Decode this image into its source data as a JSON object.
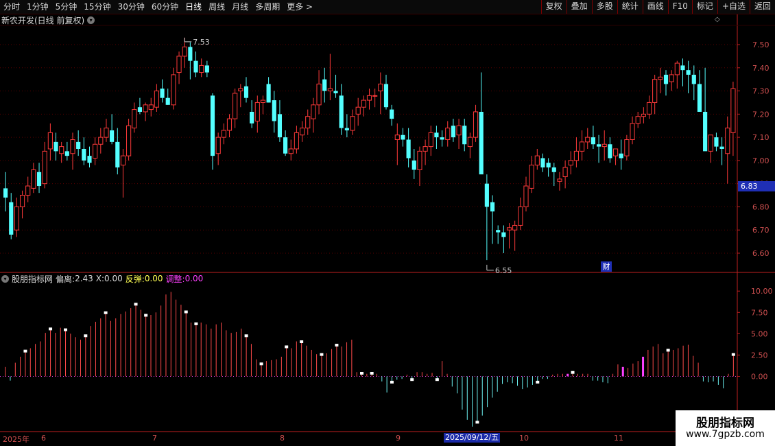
{
  "timeframes": [
    "分时",
    "1分钟",
    "5分钟",
    "15分钟",
    "30分钟",
    "60分钟",
    "日线",
    "周线",
    "月线",
    "多周期",
    "更多 >"
  ],
  "active_timeframe": "日线",
  "tools": [
    "复权",
    "叠加",
    "多股",
    "统计",
    "画线",
    "F10",
    "标记",
    "+自选",
    "返回"
  ],
  "stock_title": "新农开发(日线 前复权)",
  "indicator": {
    "name": "股朋指标网",
    "pianli_label": "偏离:",
    "pianli_value": "2.43",
    "x_label": "X:",
    "x_value": "0.00",
    "fantan_label": "反弹:",
    "fantan_value": "0.00",
    "tiaozheng_label": "调整:",
    "tiaozheng_value": "0.00"
  },
  "current_price_tag": "6.83",
  "cai_badge": "财",
  "date_badge": "2025/09/12/五",
  "year_label": "2025年",
  "month_labels": [
    "6",
    "7",
    "8",
    "9",
    "10",
    "11"
  ],
  "watermark": {
    "title": "股朋指标网",
    "url": "www.7gpzb.com"
  },
  "colors": {
    "up": "#ff3a3a",
    "down": "#54ffff",
    "pink": "#ff40ff",
    "yellow": "#ffff54",
    "axis": "#c02020"
  },
  "chart_data": [
    {
      "type": "candlestick",
      "title": "新农开发(日线 前复权)",
      "y_ticks": [
        "7.50",
        "7.40",
        "7.30",
        "7.20",
        "7.10",
        "7.00",
        "6.90",
        "6.80",
        "6.70",
        "6.60"
      ],
      "ylim": [
        6.52,
        7.58
      ],
      "annotations": [
        {
          "text": "7.53",
          "value": 7.53
        },
        {
          "text": "6.55",
          "value": 6.55
        }
      ],
      "ohlc": [
        [
          6.88,
          6.95,
          6.78,
          6.84
        ],
        [
          6.82,
          6.86,
          6.66,
          6.68
        ],
        [
          6.7,
          6.84,
          6.67,
          6.8
        ],
        [
          6.8,
          6.87,
          6.75,
          6.85
        ],
        [
          6.85,
          6.93,
          6.82,
          6.89
        ],
        [
          6.88,
          6.99,
          6.86,
          6.96
        ],
        [
          6.95,
          6.99,
          6.86,
          6.89
        ],
        [
          6.9,
          7.08,
          6.88,
          7.04
        ],
        [
          7.05,
          7.16,
          7.0,
          7.12
        ],
        [
          7.08,
          7.12,
          7.0,
          7.04
        ],
        [
          7.03,
          7.08,
          6.99,
          7.06
        ],
        [
          7.04,
          7.08,
          7.0,
          7.02
        ],
        [
          7.03,
          7.12,
          6.96,
          7.09
        ],
        [
          7.08,
          7.13,
          7.02,
          7.05
        ],
        [
          7.05,
          7.1,
          6.98,
          7.0
        ],
        [
          7.02,
          7.06,
          6.97,
          6.99
        ],
        [
          7.01,
          7.1,
          6.98,
          7.07
        ],
        [
          7.07,
          7.14,
          7.03,
          7.1
        ],
        [
          7.1,
          7.18,
          7.08,
          7.14
        ],
        [
          7.13,
          7.2,
          7.07,
          7.08
        ],
        [
          7.08,
          7.14,
          6.94,
          6.97
        ],
        [
          6.98,
          7.05,
          6.84,
          7.02
        ],
        [
          7.02,
          7.18,
          7.0,
          7.15
        ],
        [
          7.14,
          7.25,
          7.12,
          7.22
        ],
        [
          7.23,
          7.27,
          7.2,
          7.21
        ],
        [
          7.21,
          7.25,
          7.17,
          7.24
        ],
        [
          7.22,
          7.27,
          7.19,
          7.24
        ],
        [
          7.23,
          7.33,
          7.21,
          7.3
        ],
        [
          7.31,
          7.35,
          7.25,
          7.27
        ],
        [
          7.27,
          7.31,
          7.24,
          7.24
        ],
        [
          7.24,
          7.4,
          7.22,
          7.37
        ],
        [
          7.38,
          7.47,
          7.33,
          7.45
        ],
        [
          7.45,
          7.53,
          7.4,
          7.49
        ],
        [
          7.49,
          7.51,
          7.35,
          7.43
        ],
        [
          7.43,
          7.47,
          7.36,
          7.38
        ],
        [
          7.38,
          7.44,
          7.36,
          7.41
        ],
        [
          7.41,
          7.43,
          7.36,
          7.38
        ],
        [
          7.28,
          7.29,
          6.96,
          7.02
        ],
        [
          7.03,
          7.12,
          6.98,
          7.1
        ],
        [
          7.1,
          7.16,
          7.07,
          7.13
        ],
        [
          7.13,
          7.2,
          7.1,
          7.18
        ],
        [
          7.18,
          7.31,
          7.14,
          7.29
        ],
        [
          7.3,
          7.33,
          7.23,
          7.31
        ],
        [
          7.32,
          7.36,
          7.25,
          7.27
        ],
        [
          7.21,
          7.26,
          7.14,
          7.16
        ],
        [
          7.17,
          7.28,
          7.12,
          7.25
        ],
        [
          7.25,
          7.28,
          7.2,
          7.26
        ],
        [
          7.33,
          7.36,
          7.25,
          7.25
        ],
        [
          7.26,
          7.3,
          7.12,
          7.17
        ],
        [
          7.2,
          7.26,
          7.08,
          7.1
        ],
        [
          7.1,
          7.13,
          7.02,
          7.03
        ],
        [
          7.03,
          7.09,
          7.0,
          7.05
        ],
        [
          7.05,
          7.15,
          7.03,
          7.12
        ],
        [
          7.11,
          7.17,
          7.08,
          7.14
        ],
        [
          7.14,
          7.22,
          7.11,
          7.19
        ],
        [
          7.18,
          7.27,
          7.12,
          7.24
        ],
        [
          7.24,
          7.39,
          7.2,
          7.33
        ],
        [
          7.35,
          7.4,
          7.25,
          7.3
        ],
        [
          7.3,
          7.46,
          7.26,
          7.31
        ],
        [
          7.3,
          7.37,
          7.27,
          7.29
        ],
        [
          7.28,
          7.33,
          7.11,
          7.14
        ],
        [
          7.14,
          7.2,
          7.1,
          7.13
        ],
        [
          7.13,
          7.22,
          7.11,
          7.19
        ],
        [
          7.2,
          7.27,
          7.15,
          7.23
        ],
        [
          7.23,
          7.28,
          7.19,
          7.26
        ],
        [
          7.26,
          7.31,
          7.22,
          7.28
        ],
        [
          7.28,
          7.31,
          7.23,
          7.28
        ],
        [
          7.3,
          7.38,
          7.2,
          7.33
        ],
        [
          7.33,
          7.37,
          7.22,
          7.23
        ],
        [
          7.22,
          7.24,
          7.15,
          7.18
        ],
        [
          7.09,
          7.16,
          6.98,
          7.11
        ],
        [
          7.11,
          7.14,
          7.06,
          7.09
        ],
        [
          7.09,
          7.14,
          6.97,
          7.01
        ],
        [
          7.0,
          7.05,
          6.92,
          6.96
        ],
        [
          6.96,
          7.06,
          6.89,
          7.04
        ],
        [
          7.04,
          7.09,
          6.98,
          7.06
        ],
        [
          7.06,
          7.15,
          7.02,
          7.12
        ],
        [
          7.12,
          7.15,
          7.05,
          7.1
        ],
        [
          7.1,
          7.13,
          7.06,
          7.09
        ],
        [
          7.09,
          7.17,
          7.06,
          7.14
        ],
        [
          7.15,
          7.18,
          7.08,
          7.1
        ],
        [
          7.11,
          7.18,
          7.05,
          7.15
        ],
        [
          7.15,
          7.18,
          7.04,
          7.07
        ],
        [
          7.06,
          7.12,
          7.01,
          7.1
        ],
        [
          7.1,
          7.24,
          7.08,
          7.21
        ],
        [
          7.21,
          7.38,
          6.95,
          6.94
        ],
        [
          6.9,
          6.94,
          6.57,
          6.8
        ],
        [
          6.82,
          6.85,
          6.64,
          6.78
        ],
        [
          6.7,
          6.72,
          6.64,
          6.69
        ],
        [
          6.69,
          6.72,
          6.6,
          6.67
        ],
        [
          6.7,
          6.73,
          6.62,
          6.71
        ],
        [
          6.7,
          6.74,
          6.61,
          6.72
        ],
        [
          6.72,
          6.84,
          6.7,
          6.8
        ],
        [
          6.8,
          6.93,
          6.78,
          6.89
        ],
        [
          6.88,
          7.02,
          6.86,
          6.98
        ],
        [
          6.98,
          7.05,
          6.96,
          7.02
        ],
        [
          7.01,
          7.03,
          6.95,
          6.97
        ],
        [
          6.99,
          7.01,
          6.93,
          6.97
        ],
        [
          6.97,
          6.99,
          6.89,
          6.95
        ],
        [
          6.91,
          6.95,
          6.87,
          6.92
        ],
        [
          6.93,
          7.0,
          6.88,
          6.97
        ],
        [
          6.98,
          7.04,
          6.94,
          7.0
        ],
        [
          7.0,
          7.1,
          6.97,
          7.04
        ],
        [
          7.04,
          7.13,
          7.0,
          7.08
        ],
        [
          7.08,
          7.14,
          7.05,
          7.1
        ],
        [
          7.1,
          7.15,
          7.05,
          7.07
        ],
        [
          7.07,
          7.11,
          6.99,
          7.06
        ],
        [
          7.06,
          7.13,
          7.0,
          7.07
        ],
        [
          7.07,
          7.1,
          6.99,
          7.01
        ],
        [
          7.02,
          7.05,
          6.98,
          7.05
        ],
        [
          7.03,
          7.09,
          6.96,
          7.01
        ],
        [
          7.02,
          7.11,
          7.0,
          7.09
        ],
        [
          7.09,
          7.19,
          7.07,
          7.16
        ],
        [
          7.16,
          7.21,
          7.14,
          7.19
        ],
        [
          7.19,
          7.23,
          7.16,
          7.2
        ],
        [
          7.2,
          7.28,
          7.18,
          7.25
        ],
        [
          7.25,
          7.37,
          7.2,
          7.35
        ],
        [
          7.35,
          7.4,
          7.29,
          7.36
        ],
        [
          7.37,
          7.39,
          7.28,
          7.33
        ],
        [
          7.34,
          7.39,
          7.3,
          7.37
        ],
        [
          7.37,
          7.43,
          7.31,
          7.42
        ],
        [
          7.41,
          7.44,
          7.32,
          7.39
        ],
        [
          7.39,
          7.43,
          7.29,
          7.37
        ],
        [
          7.37,
          7.41,
          7.26,
          7.33
        ],
        [
          7.33,
          7.39,
          7.24,
          7.21
        ],
        [
          7.21,
          7.4,
          7.13,
          7.04
        ],
        [
          7.04,
          7.08,
          6.99,
          7.11
        ],
        [
          7.1,
          7.12,
          7.04,
          7.06
        ],
        [
          7.06,
          7.1,
          6.98,
          7.05
        ],
        [
          7.03,
          7.19,
          6.9,
          7.14
        ],
        [
          7.12,
          7.34,
          7.02,
          7.31
        ]
      ]
    },
    {
      "type": "bar",
      "title": "股朋指标网",
      "y_ticks": [
        "10.00",
        "7.50",
        "5.00",
        "2.50",
        "0.00"
      ],
      "ylim": [
        -6.4,
        10.5
      ],
      "values": [
        1.1,
        -0.5,
        1.6,
        2.3,
        2.8,
        3.3,
        3.8,
        4.1,
        5.1,
        5.4,
        5.1,
        5.7,
        5.3,
        5.0,
        4.6,
        4.3,
        4.6,
        5.9,
        6.4,
        6.8,
        7.3,
        6.5,
        6.8,
        7.3,
        7.6,
        8.0,
        8.3,
        7.8,
        7.0,
        7.2,
        7.5,
        8.3,
        9.6,
        9.9,
        9.0,
        8.4,
        7.4,
        6.3,
        6.0,
        6.3,
        6.1,
        5.6,
        6.1,
        6.3,
        5.4,
        5.1,
        5.2,
        5.6,
        4.6,
        3.8,
        2.0,
        1.3,
        1.8,
        1.9,
        2.0,
        2.3,
        3.3,
        3.3,
        4.1,
        3.9,
        3.6,
        3.1,
        2.6,
        2.4,
        2.7,
        3.2,
        3.5,
        3.5,
        4.0,
        4.3,
        0.5,
        0.2,
        0.3,
        0.2,
        0.3,
        -0.6,
        -1.9,
        -0.6,
        -0.4,
        -0.3,
        0.2,
        -0.3,
        0.5,
        0.5,
        0.3,
        0.4,
        -0.3,
        1.8,
        0.3,
        -1.2,
        -2.0,
        -3.9,
        -5.1,
        -5.9,
        -5.3,
        -4.6,
        -3.6,
        -2.5,
        -1.8,
        -0.9,
        -0.7,
        -0.8,
        -1.1,
        -1.5,
        -1.3,
        -1.0,
        -0.6,
        -0.3,
        -0.3,
        0.2,
        0.3,
        0.3,
        0.3,
        0.3,
        0.3,
        0.3,
        0.3,
        -0.5,
        -0.5,
        -0.7,
        -0.8,
        0.3,
        1.4,
        1.1,
        1.0,
        1.5,
        1.8,
        2.3,
        3.1,
        3.5,
        3.8,
        2.7,
        2.9,
        3.1,
        3.3,
        3.6,
        3.7,
        2.4,
        1.6,
        -0.6,
        -0.7,
        -0.6,
        -1.0,
        -1.4,
        0.3,
        2.4
      ],
      "pink_indices": [
        112,
        123,
        127
      ],
      "white_markers": [
        [
          11,
          3.5
        ],
        [
          23,
          4.6
        ],
        [
          33,
          4.5
        ],
        [
          42,
          7.1
        ],
        [
          55,
          8.3
        ],
        [
          70,
          9.0
        ],
        [
          75,
          3.6
        ],
        [
          96,
          5.7
        ],
        [
          103,
          1.3
        ],
        [
          129,
          4.9
        ],
        [
          138,
          2.4
        ],
        [
          150,
          4.2
        ],
        [
          160,
          -1.9
        ],
        [
          169,
          0.9
        ],
        [
          178,
          1.8
        ],
        [
          191,
          -5.3
        ],
        [
          197,
          -3.7
        ],
        [
          207,
          -0.9
        ],
        [
          219,
          -0.2
        ],
        [
          232,
          -0.6
        ],
        [
          253,
          0.5
        ],
        [
          287,
          -3.5
        ],
        [
          304,
          -1.2
        ],
        [
          356,
          3.4
        ],
        [
          390,
          -1.9
        ]
      ]
    }
  ]
}
